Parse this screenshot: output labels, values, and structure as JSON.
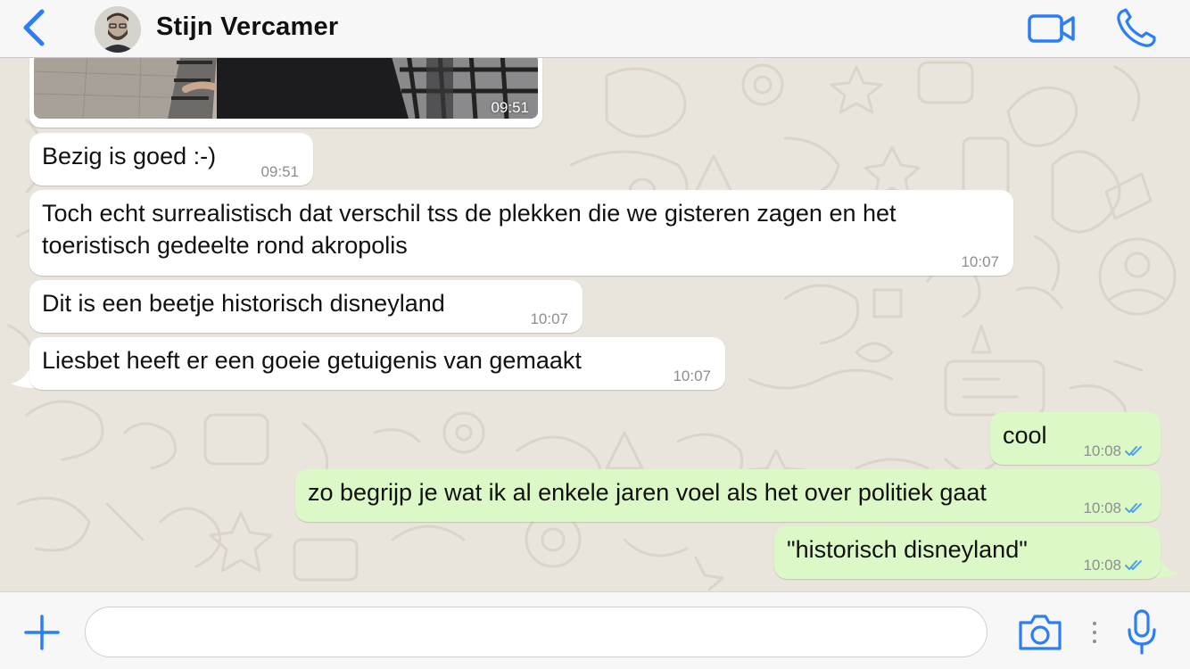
{
  "header": {
    "contact_name": "Stijn Vercamer"
  },
  "icons": {
    "back": "chevron-left-icon",
    "video": "video-camera-icon",
    "call": "phone-icon",
    "plus": "plus-icon",
    "camera": "camera-icon",
    "mic": "microphone-icon"
  },
  "colors": {
    "accent": "#2c7ef6",
    "incoming_bubble": "#ffffff",
    "outgoing_bubble": "#dcf8c6",
    "read_ticks": "#4fa3e3",
    "background": "#e9e4dc"
  },
  "messages": {
    "image_time": "09:51",
    "m1": {
      "text": "Bezig is goed :-)",
      "time": "09:51"
    },
    "m2": {
      "line1": "Toch echt surrealistisch dat verschil tss de plekken die we gisteren zagen en het",
      "line2": "toeristisch gedeelte rond akropolis",
      "time": "10:07"
    },
    "m3": {
      "text": "Dit is een beetje historisch disneyland",
      "time": "10:07"
    },
    "m4": {
      "text": "Liesbet heeft er een goeie getuigenis van gemaakt",
      "time": "10:07"
    },
    "m5": {
      "text": "cool",
      "time": "10:08"
    },
    "m6": {
      "text": "zo begrijp je wat ik al enkele jaren voel als het over politiek gaat",
      "time": "10:08"
    },
    "m7": {
      "text": "\"historisch disneyland\"",
      "time": "10:08"
    }
  },
  "composer": {
    "value": "",
    "placeholder": ""
  }
}
